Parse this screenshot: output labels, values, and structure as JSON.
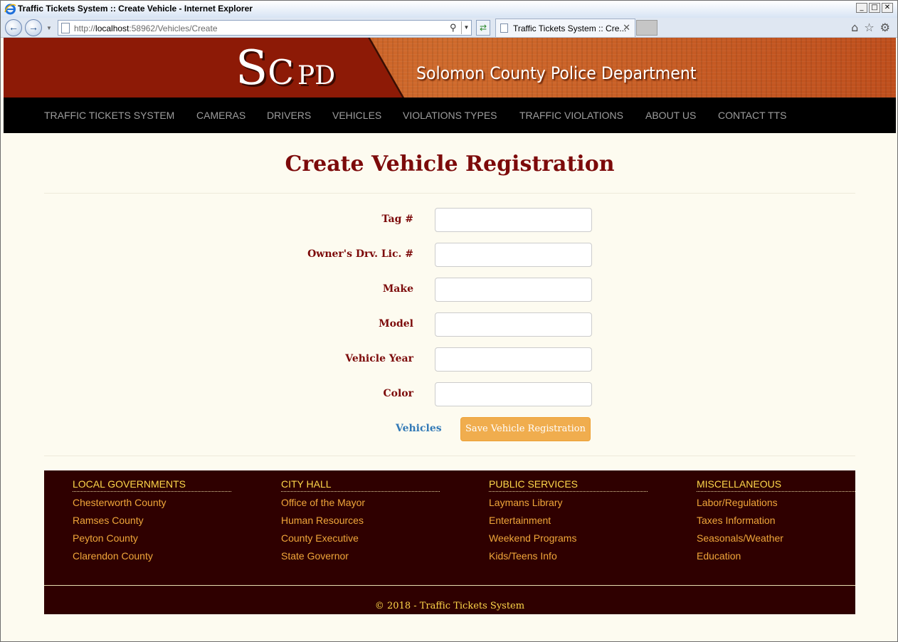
{
  "window": {
    "title": "Traffic Tickets System :: Create Vehicle - Internet Explorer",
    "minimize": "_",
    "maximize": "□",
    "close": "✕"
  },
  "browser": {
    "url_prefix": "http://",
    "url_host": "localhost",
    "url_rest": ":58962/Vehicles/Create",
    "tab_title": "Traffic Tickets System :: Cre...",
    "tab_close": "✕"
  },
  "header": {
    "logo_s": "S",
    "logo_c": "C",
    "logo_p": "P",
    "logo_d": "D",
    "department": "Solomon County Police Department"
  },
  "nav": {
    "items": [
      "TRAFFIC TICKETS SYSTEM",
      "CAMERAS",
      "DRIVERS",
      "VEHICLES",
      "VIOLATIONS TYPES",
      "TRAFFIC VIOLATIONS",
      "ABOUT US",
      "CONTACT TTS"
    ]
  },
  "main": {
    "title": "Create Vehicle Registration",
    "fields": [
      {
        "label": "Tag #",
        "value": ""
      },
      {
        "label": "Owner's Drv. Lic. #",
        "value": ""
      },
      {
        "label": "Make",
        "value": ""
      },
      {
        "label": "Model",
        "value": ""
      },
      {
        "label": "Vehicle Year",
        "value": ""
      },
      {
        "label": "Color",
        "value": ""
      }
    ],
    "back_link": "Vehicles",
    "save_button": "Save Vehicle Registration"
  },
  "footer": {
    "columns": [
      {
        "heading": "LOCAL GOVERNMENTS",
        "links": [
          "Chesterworth County",
          "Ramses County",
          "Peyton County",
          "Clarendon County"
        ]
      },
      {
        "heading": "CITY HALL",
        "links": [
          "Office of the Mayor",
          "Human Resources",
          "County Executive",
          "State Governor"
        ]
      },
      {
        "heading": "PUBLIC SERVICES",
        "links": [
          "Laymans Library",
          "Entertainment",
          "Weekend Programs",
          "Kids/Teens Info"
        ]
      },
      {
        "heading": "MISCELLANEOUS",
        "links": [
          "Labor/Regulations",
          "Taxes Information",
          "Seasonals/Weather",
          "Education"
        ]
      }
    ],
    "copyright": "© 2018 - Traffic Tickets System"
  },
  "colors": {
    "heading": "#7c0a0a",
    "navbar_bg": "#000000",
    "nav_text": "#9d9d9d",
    "footer_bg": "#2f0000",
    "footer_heading": "#ffd84a",
    "footer_link": "#f0a63a",
    "save_button": "#f0ad4e",
    "link": "#337ab7"
  }
}
